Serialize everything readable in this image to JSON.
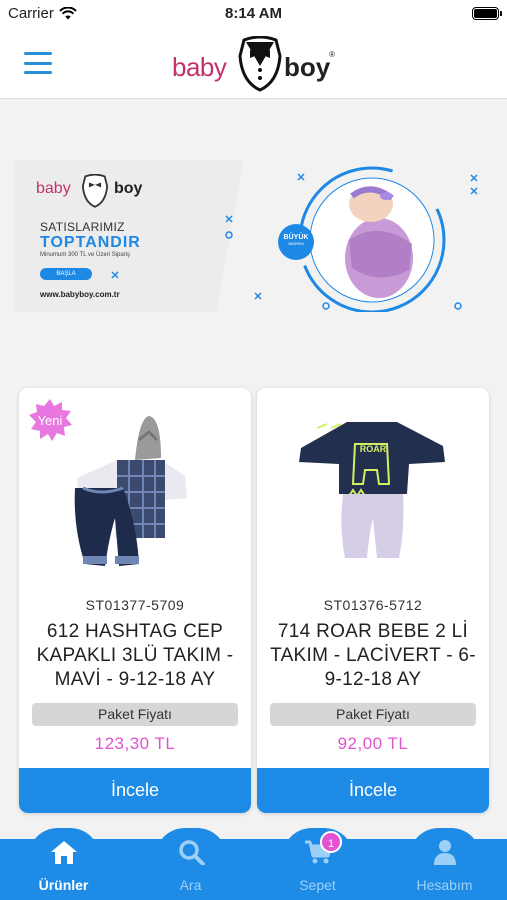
{
  "status_bar": {
    "carrier": "Carrier",
    "time": "8:14 AM"
  },
  "header": {
    "logo_left": "baby",
    "logo_right": "boy",
    "logo_mark": "®"
  },
  "banner": {
    "logo_left": "baby",
    "logo_right": "boy",
    "line1": "SATISLARIMIZ",
    "line2": "TOPTANDIR",
    "line3": "Minumum 300 TL ve Üzeri Sipariş",
    "button": "BAŞLA",
    "url": "www.babyboy.com.tr",
    "tag": "BÜYÜK",
    "tag_sub": "İNDİRİM"
  },
  "products": [
    {
      "badge": "Yeni",
      "code": "ST01377-5709",
      "title": "612 HASHTAG CEP KAPAKLI 3LÜ TAKIM - MAVİ - 9-12-18 AY",
      "price_label": "Paket Fiyatı",
      "price": "123,30  TL",
      "action": "İncele"
    },
    {
      "code": "ST01376-5712",
      "title": "714 ROAR BEBE 2 Lİ TAKIM  - LACİVERT - 6-9-12-18 AY",
      "price_label": "Paket Fiyatı",
      "price": "92,00  TL",
      "action": "İncele",
      "print": "ROAR"
    }
  ],
  "tabs": [
    {
      "label": "Ürünler",
      "icon": "home-icon",
      "active": true
    },
    {
      "label": "Ara",
      "icon": "search-icon",
      "active": false
    },
    {
      "label": "Sepet",
      "icon": "cart-icon",
      "active": false,
      "count": "1"
    },
    {
      "label": "Hesabım",
      "icon": "user-icon",
      "active": false
    }
  ],
  "colors": {
    "accent": "#1e8be6",
    "price": "#e353d0",
    "brand_pink": "#c2336b"
  }
}
